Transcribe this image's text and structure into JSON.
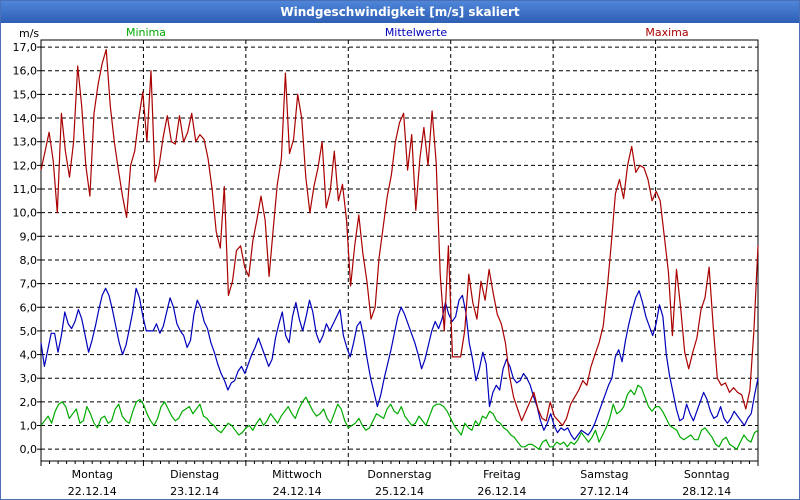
{
  "window": {
    "title": "Windgeschwindigkeit [m/s] skaliert"
  },
  "chart_data": {
    "type": "line",
    "title": "Windgeschwindigkeit [m/s] skaliert",
    "ylabel": "m/s",
    "ylim": [
      -0.5,
      17.3
    ],
    "yticks": [
      "0,0",
      "1,0",
      "2,0",
      "3,0",
      "4,0",
      "5,0",
      "6,0",
      "7,0",
      "8,0",
      "9,0",
      "10,0",
      "11,0",
      "12,0",
      "13,0",
      "14,0",
      "15,0",
      "16,0",
      "17,0"
    ],
    "day_labels": [
      {
        "day": "Montag",
        "date": "22.12.14"
      },
      {
        "day": "Dienstag",
        "date": "23.12.14"
      },
      {
        "day": "Mittwoch",
        "date": "24.12.14"
      },
      {
        "day": "Donnerstag",
        "date": "25.12.14"
      },
      {
        "day": "Freitag",
        "date": "26.12.14"
      },
      {
        "day": "Samstag",
        "date": "27.12.14"
      },
      {
        "day": "Sonntag",
        "date": "28.12.14"
      }
    ],
    "grid": true,
    "legend_position": "top",
    "x_days": 7,
    "samples_per_day": 24,
    "series": [
      {
        "name": "Minima",
        "color": "#00aa00",
        "values": [
          1.0,
          1.2,
          1.4,
          1.1,
          1.6,
          1.9,
          2.0,
          1.8,
          1.3,
          1.5,
          1.7,
          1.1,
          1.2,
          1.8,
          1.5,
          1.1,
          0.9,
          1.3,
          1.4,
          1.1,
          1.2,
          1.7,
          1.9,
          1.4,
          1.2,
          1.1,
          1.6,
          2.0,
          2.1,
          1.9,
          1.5,
          1.2,
          1.0,
          1.3,
          1.8,
          2.0,
          1.7,
          1.4,
          1.2,
          1.3,
          1.6,
          1.7,
          1.8,
          1.5,
          1.7,
          1.9,
          1.4,
          1.3,
          1.1,
          1.0,
          0.8,
          0.7,
          0.9,
          1.1,
          1.0,
          0.8,
          0.6,
          0.7,
          0.9,
          1.0,
          0.8,
          1.1,
          1.3,
          1.0,
          1.2,
          1.5,
          1.3,
          1.1,
          1.4,
          1.6,
          1.8,
          1.5,
          1.3,
          1.7,
          2.0,
          2.2,
          1.9,
          1.6,
          1.4,
          1.5,
          1.7,
          1.3,
          1.1,
          1.5,
          1.9,
          1.7,
          1.2,
          0.9,
          1.0,
          1.1,
          1.3,
          1.0,
          0.8,
          0.9,
          1.2,
          1.5,
          1.4,
          1.3,
          1.7,
          1.9,
          1.6,
          1.5,
          1.8,
          1.4,
          1.2,
          1.0,
          1.1,
          1.4,
          1.2,
          1.0,
          1.4,
          1.8,
          1.9,
          1.9,
          1.8,
          1.6,
          1.3,
          1.0,
          0.8,
          0.6,
          1.1,
          0.9,
          0.8,
          1.2,
          1.0,
          1.4,
          1.3,
          1.6,
          1.5,
          1.2,
          1.1,
          0.9,
          0.8,
          0.6,
          0.5,
          0.3,
          0.1,
          0.1,
          0.2,
          0.2,
          0.1,
          0.0,
          0.3,
          0.4,
          0.1,
          0.1,
          0.3,
          0.2,
          0.3,
          0.1,
          0.3,
          0.2,
          0.4,
          0.7,
          0.5,
          0.3,
          0.5,
          0.8,
          0.3,
          0.6,
          0.9,
          1.3,
          1.9,
          1.5,
          1.6,
          1.8,
          2.3,
          2.5,
          2.3,
          2.7,
          2.6,
          2.2,
          1.8,
          1.6,
          1.8,
          1.8,
          1.6,
          1.3,
          1.0,
          0.9,
          0.8,
          0.5,
          0.4,
          0.5,
          0.6,
          0.4,
          0.4,
          0.8,
          0.9,
          0.7,
          0.5,
          0.2,
          0.1,
          0.4,
          0.5,
          0.2,
          0.1,
          0.0,
          0.3,
          0.6,
          0.4,
          0.3,
          0.7,
          0.8
        ]
      },
      {
        "name": "Mittelwerte",
        "color": "#0000bb",
        "values": [
          4.5,
          3.5,
          4.2,
          4.9,
          4.9,
          4.1,
          4.8,
          5.8,
          5.3,
          5.1,
          5.4,
          5.9,
          5.5,
          4.8,
          4.1,
          4.6,
          5.2,
          5.9,
          6.5,
          6.8,
          6.5,
          5.9,
          5.2,
          4.5,
          4.0,
          4.4,
          5.1,
          5.8,
          6.8,
          6.4,
          5.6,
          5.0,
          5.0,
          5.0,
          5.3,
          4.9,
          5.2,
          5.8,
          6.4,
          6.0,
          5.3,
          5.0,
          4.8,
          4.3,
          4.6,
          5.7,
          6.3,
          6.0,
          5.4,
          5.1,
          4.5,
          4.1,
          3.6,
          3.2,
          2.9,
          2.5,
          2.8,
          2.9,
          3.3,
          3.5,
          3.2,
          3.6,
          4.0,
          4.3,
          4.7,
          4.3,
          3.9,
          3.5,
          3.8,
          4.7,
          5.3,
          5.8,
          4.8,
          4.5,
          5.6,
          6.2,
          5.5,
          5.0,
          5.6,
          6.3,
          5.8,
          4.9,
          4.5,
          4.8,
          5.3,
          5.0,
          5.3,
          5.6,
          5.9,
          4.8,
          4.3,
          3.9,
          4.5,
          5.2,
          5.4,
          4.7,
          3.8,
          3.0,
          2.4,
          1.8,
          2.3,
          3.0,
          3.6,
          4.2,
          4.9,
          5.6,
          6.0,
          5.7,
          5.3,
          4.9,
          4.5,
          4.0,
          3.4,
          3.8,
          4.4,
          5.0,
          5.4,
          5.1,
          5.5,
          6.2,
          5.7,
          5.4,
          5.6,
          6.3,
          6.5,
          5.8,
          4.5,
          3.8,
          2.9,
          3.4,
          4.1,
          3.6,
          1.8,
          2.4,
          2.7,
          2.5,
          3.4,
          3.8,
          3.5,
          3.0,
          2.8,
          2.9,
          3.2,
          3.0,
          2.7,
          2.2,
          1.8,
          1.2,
          0.8,
          1.1,
          1.5,
          1.0,
          0.7,
          0.9,
          0.8,
          0.9,
          0.6,
          0.4,
          0.6,
          0.8,
          0.7,
          0.6,
          0.8,
          1.1,
          1.5,
          1.9,
          2.3,
          2.7,
          3.0,
          3.9,
          4.2,
          3.7,
          4.6,
          5.3,
          5.9,
          6.4,
          6.7,
          6.2,
          5.6,
          5.2,
          4.8,
          5.3,
          6.1,
          5.6,
          4.0,
          3.1,
          2.4,
          1.7,
          1.2,
          1.3,
          1.9,
          1.5,
          1.2,
          1.6,
          2.0,
          2.4,
          2.1,
          1.6,
          1.3,
          1.4,
          1.8,
          1.3,
          1.1,
          1.3,
          1.6,
          1.4,
          1.2,
          1.0,
          1.3,
          1.5,
          2.3,
          3.0
        ]
      },
      {
        "name": "Maxima",
        "color": "#aa0000",
        "values": [
          11.8,
          12.6,
          13.4,
          12.2,
          10.0,
          14.2,
          12.6,
          11.5,
          13.0,
          16.2,
          14.5,
          12.0,
          10.7,
          14.2,
          15.4,
          16.3,
          16.9,
          14.5,
          13.0,
          11.8,
          10.7,
          9.8,
          12.0,
          12.6,
          14.0,
          15.1,
          13.0,
          16.0,
          11.3,
          12.0,
          13.2,
          14.1,
          13.0,
          12.9,
          14.1,
          13.0,
          13.4,
          14.2,
          13.0,
          13.3,
          13.1,
          12.3,
          11.0,
          9.2,
          8.5,
          11.1,
          6.5,
          7.1,
          8.4,
          8.6,
          7.7,
          7.3,
          8.8,
          9.7,
          10.7,
          9.7,
          7.3,
          9.3,
          11.2,
          12.3,
          15.9,
          12.5,
          13.1,
          15.0,
          14.0,
          11.5,
          10.0,
          11.1,
          11.9,
          13.0,
          10.2,
          10.9,
          12.6,
          10.5,
          11.2,
          9.7,
          6.9,
          8.6,
          9.9,
          8.3,
          7.1,
          5.5,
          6.0,
          8.1,
          9.4,
          10.7,
          11.6,
          13.0,
          13.8,
          14.2,
          11.8,
          13.3,
          10.1,
          12.3,
          13.6,
          12.0,
          14.3,
          12.1,
          7.4,
          5.0,
          8.6,
          3.9,
          3.9,
          3.9,
          5.0,
          7.4,
          6.2,
          5.5,
          7.1,
          6.3,
          7.6,
          6.6,
          5.7,
          5.3,
          4.5,
          3.1,
          2.2,
          1.7,
          1.2,
          1.6,
          2.0,
          2.4,
          1.7,
          1.3,
          1.2,
          2.0,
          1.4,
          1.2,
          1.0,
          1.3,
          1.9,
          2.2,
          2.5,
          2.9,
          2.7,
          3.5,
          4.0,
          4.5,
          5.2,
          6.8,
          8.7,
          10.8,
          11.4,
          10.6,
          12.0,
          12.8,
          11.7,
          12.0,
          11.9,
          11.4,
          10.5,
          10.9,
          10.5,
          9.0,
          7.5,
          4.8,
          7.6,
          6.0,
          4.1,
          3.4,
          4.1,
          4.7,
          5.9,
          6.4,
          7.7,
          5.2,
          3.0,
          2.7,
          2.8,
          2.4,
          2.6,
          2.4,
          2.3,
          1.7,
          2.5,
          5.0,
          8.6
        ]
      }
    ]
  }
}
